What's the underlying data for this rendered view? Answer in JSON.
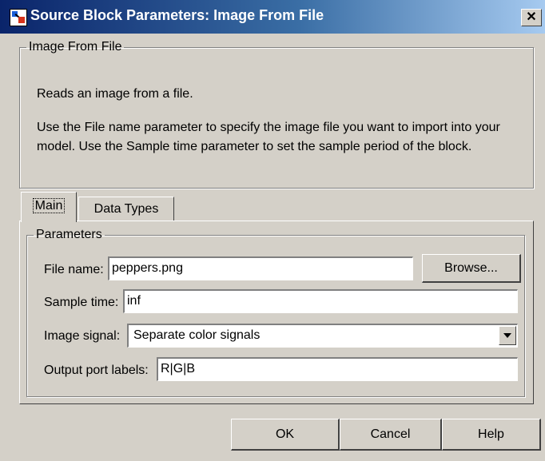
{
  "window": {
    "title": "Source Block Parameters: Image From File",
    "close_label": "✕"
  },
  "description": {
    "group_title": "Image From File",
    "line1": "Reads an image from a file.",
    "line2": "Use the File name parameter to specify the image file you want to import into your",
    "line3": "model. Use the Sample time parameter to set the sample period of the block."
  },
  "tabs": [
    {
      "label": "Main",
      "active": true
    },
    {
      "label": "Data Types",
      "active": false
    }
  ],
  "parameters": {
    "group_title": "Parameters",
    "file_name": {
      "label": "File name:",
      "value": "peppers.png",
      "button": "Browse..."
    },
    "sample_time": {
      "label": "Sample time:",
      "value": "inf"
    },
    "image_signal": {
      "label": "Image signal:",
      "value": "Separate color signals"
    },
    "output_port_labels": {
      "label": "Output port labels:",
      "value": "R|G|B"
    }
  },
  "buttons": {
    "ok": "OK",
    "cancel": "Cancel",
    "help": "Help"
  },
  "colors": {
    "face": "#d4d0c8",
    "title_start": "#0a246a",
    "title_end": "#a6caf0"
  }
}
